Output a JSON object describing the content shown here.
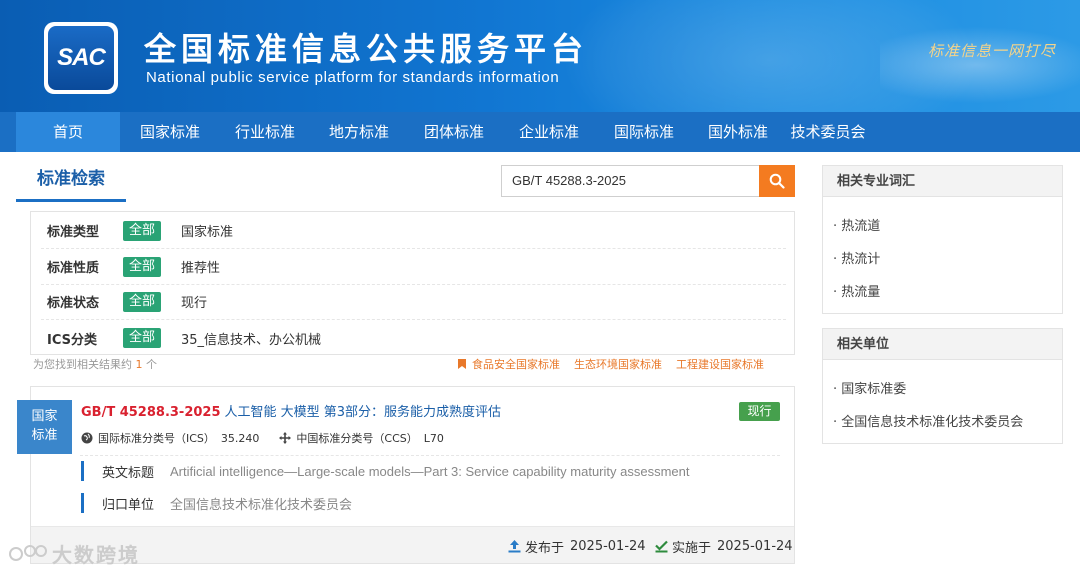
{
  "header": {
    "logo_text": "SAC",
    "title": "全国标准信息公共服务平台",
    "subtitle": "National public service platform  for standards information",
    "slogan": "标准信息一网打尽"
  },
  "nav": {
    "items": [
      {
        "label": "首页",
        "active": true
      },
      {
        "label": "国家标准",
        "active": false
      },
      {
        "label": "行业标准",
        "active": false
      },
      {
        "label": "地方标准",
        "active": false
      },
      {
        "label": "团体标准",
        "active": false
      },
      {
        "label": "企业标准",
        "active": false
      },
      {
        "label": "国际标准",
        "active": false
      },
      {
        "label": "国外标准",
        "active": false
      },
      {
        "label": "技术委员会",
        "active": false
      }
    ]
  },
  "search": {
    "tab_label": "标准检索",
    "query": "GB/T 45288.3-2025",
    "button_icon": "search-icon"
  },
  "filters": [
    {
      "label": "标准类型",
      "tag": "全部",
      "value": "国家标准"
    },
    {
      "label": "标准性质",
      "tag": "全部",
      "value": "推荐性"
    },
    {
      "label": "标准状态",
      "tag": "全部",
      "value": "现行"
    },
    {
      "label": "ICS分类",
      "tag": "全部",
      "value": "35_信息技术、办公机械"
    }
  ],
  "result_summary": {
    "prefix": "为您找到相关结果约",
    "count": "1",
    "suffix": "个"
  },
  "quick_links": [
    "食品安全国家标准",
    "生态环境国家标准",
    "工程建设国家标准"
  ],
  "result": {
    "badge_line1": "国家",
    "badge_line2": "标准",
    "code": "GB/T 45288.3-2025",
    "name": "人工智能 大模型 第3部分：服务能力成熟度评估",
    "status": "现行",
    "ics_label": "国际标准分类号（ICS）",
    "ics_value": "35.240",
    "ccs_label": "中国标准分类号（CCS）",
    "ccs_value": "L70",
    "english_title_label": "英文标题",
    "english_title": "Artificial intelligence—Large-scale models—Part 3: Service capability maturity assessment",
    "unit_label": "归口单位",
    "unit_value": "全国信息技术标准化技术委员会",
    "published_label": "发布于",
    "published_date": "2025-01-24",
    "effective_label": "实施于",
    "effective_date": "2025-01-24"
  },
  "sidebar": {
    "terms_title": "相关专业词汇",
    "terms": [
      "热流道",
      "热流计",
      "热流量"
    ],
    "units_title": "相关单位",
    "units": [
      "国家标准委",
      "全国信息技术标准化技术委员会"
    ]
  },
  "watermark": "大数跨境",
  "colors": {
    "header_blue": "#1176d2",
    "nav_blue": "#1b6fc4",
    "accent_orange": "#f47b20",
    "tag_green": "#2aa375",
    "status_green": "#46a04d",
    "code_red": "#d9212f"
  }
}
